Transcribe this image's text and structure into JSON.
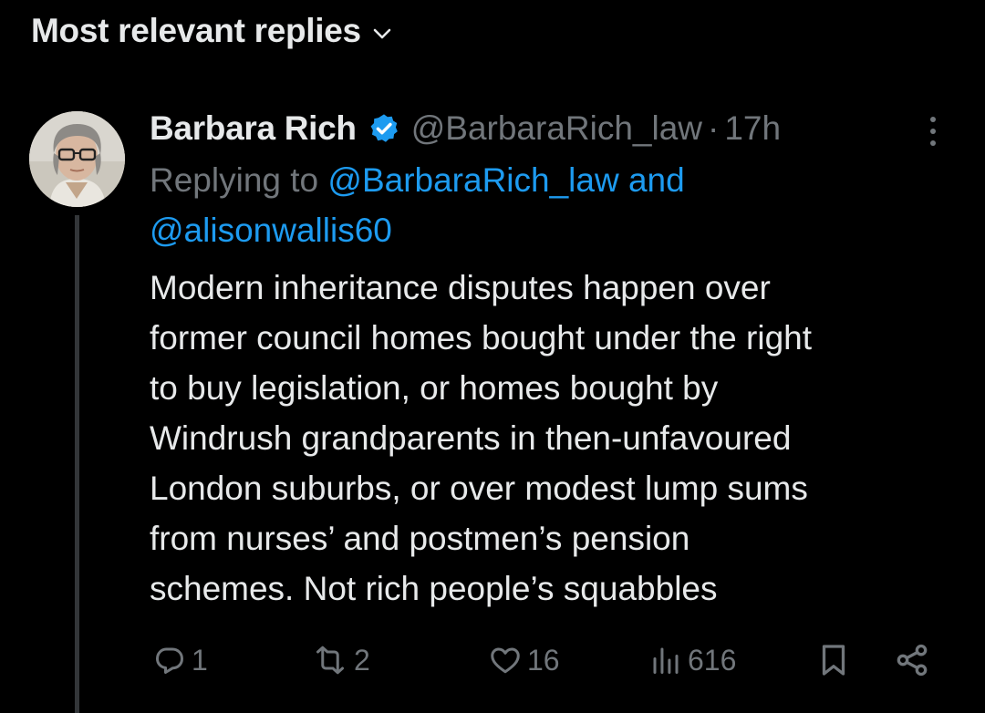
{
  "sort": {
    "label": "Most relevant replies",
    "chevron_icon": "chevron-down-icon"
  },
  "tweet": {
    "author": {
      "name": "Barbara Rich",
      "handle": "@BarbaraRich_law",
      "verified_icon": "verified-badge-icon",
      "verified_color": "#1d9bf0"
    },
    "separator": "·",
    "time": "17h",
    "replying_prefix": "Replying to",
    "mention1": "@BarbaraRich_law",
    "mention_and": "and",
    "mention2": "@alisonwallis60",
    "text": "Modern inheritance disputes happen over\nformer council homes bought under the right\nto buy legislation, or homes bought by\nWindrush grandparents in then-unfavoured\nLondon suburbs, or over modest lump sums\nfrom nurses’ and postmen’s pension\nschemes. Not rich people’s squabbles",
    "actions": {
      "replies": "1",
      "reposts": "2",
      "likes": "16",
      "views": "616"
    }
  },
  "colors": {
    "background": "#000000",
    "text": "#e7e9ea",
    "secondary": "#71767b",
    "accent": "#1d9bf0"
  }
}
